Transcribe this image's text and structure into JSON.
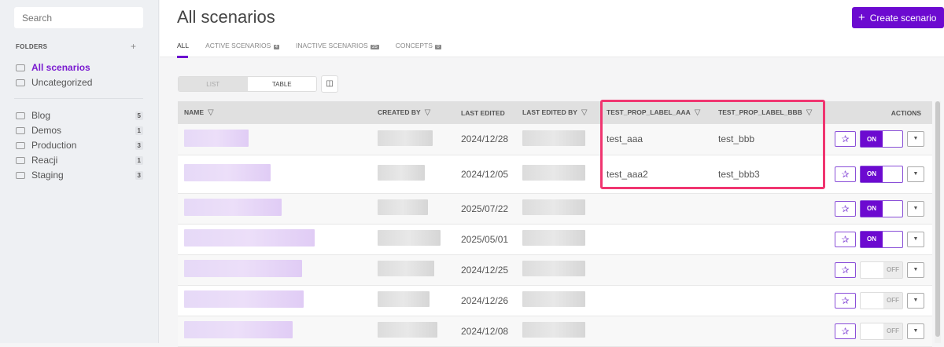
{
  "sidebar": {
    "search_placeholder": "Search",
    "folders_label": "FOLDERS",
    "add_folder": "+",
    "top_items": [
      {
        "label": "All scenarios",
        "active": true
      },
      {
        "label": "Uncategorized"
      }
    ],
    "folders": [
      {
        "label": "Blog",
        "count": "5"
      },
      {
        "label": "Demos",
        "count": "1"
      },
      {
        "label": "Production",
        "count": "3"
      },
      {
        "label": "Reacji",
        "count": "1"
      },
      {
        "label": "Staging",
        "count": "3"
      }
    ]
  },
  "header": {
    "title": "All scenarios",
    "create_icon": "+",
    "create_label": "Create scenario",
    "tabs": [
      {
        "label": "ALL"
      },
      {
        "label": "ACTIVE SCENARIOS",
        "count": "4"
      },
      {
        "label": "INACTIVE SCENARIOS",
        "count": "25"
      },
      {
        "label": "CONCEPTS",
        "count": "0"
      }
    ]
  },
  "view": {
    "list": "LIST",
    "table": "TABLE",
    "columns_icon": "columns-settings-icon"
  },
  "table": {
    "columns": [
      "NAME",
      "CREATED BY",
      "LAST EDITED",
      "LAST EDITED BY",
      "TEST_PROP_LABEL_AAA",
      "TEST_PROP_LABEL_BBB",
      "ACTIONS"
    ],
    "rows": [
      {
        "last_edited": "2024/12/28",
        "aaa": "test_aaa",
        "bbb": "test_bbb",
        "status": "ON"
      },
      {
        "last_edited": "2024/12/05",
        "aaa": "test_aaa2",
        "bbb": "test_bbb3",
        "status": "ON"
      },
      {
        "last_edited": "2025/07/22",
        "aaa": "",
        "bbb": "",
        "status": "ON"
      },
      {
        "last_edited": "2025/05/01",
        "aaa": "",
        "bbb": "",
        "status": "ON"
      },
      {
        "last_edited": "2024/12/25",
        "aaa": "",
        "bbb": "",
        "status": "OFF"
      },
      {
        "last_edited": "2024/12/26",
        "aaa": "",
        "bbb": "",
        "status": "OFF"
      },
      {
        "last_edited": "2024/12/08",
        "aaa": "",
        "bbb": "",
        "status": "OFF"
      }
    ]
  },
  "colors": {
    "accent": "#6c0ad0",
    "highlight": "#f03570"
  }
}
